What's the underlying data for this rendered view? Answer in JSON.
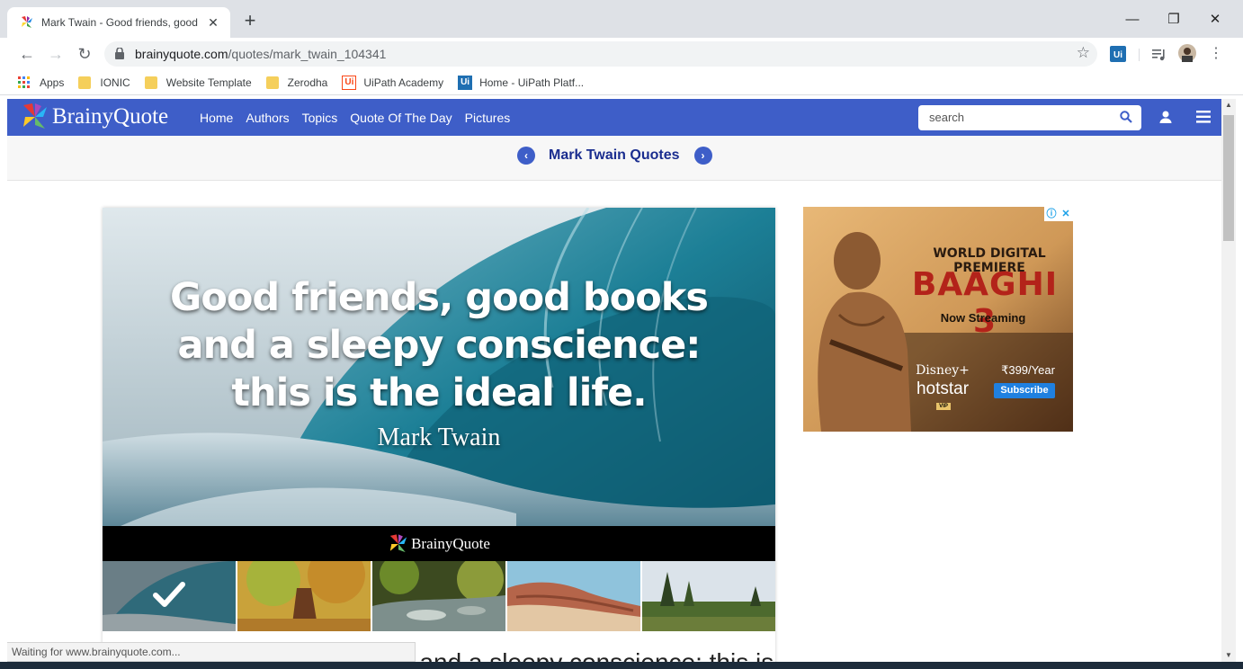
{
  "browser": {
    "tab_title": "Mark Twain - Good friends, good",
    "url_domain": "brainyquote.com",
    "url_path": "/quotes/mark_twain_104341",
    "status_text": "Waiting for www.brainyquote.com..."
  },
  "bookmarks": [
    {
      "label": "Apps",
      "icon": "apps-grid-icon"
    },
    {
      "label": "IONIC",
      "icon": "folder-icon"
    },
    {
      "label": "Website Template",
      "icon": "folder-icon"
    },
    {
      "label": "Zerodha",
      "icon": "folder-icon"
    },
    {
      "label": "UiPath Academy",
      "icon": "uipath-icon"
    },
    {
      "label": "Home - UiPath Platf...",
      "icon": "uipath-icon"
    }
  ],
  "site": {
    "brand": "BrainyQuote",
    "nav": [
      "Home",
      "Authors",
      "Topics",
      "Quote Of The Day",
      "Pictures"
    ],
    "search_placeholder": "search",
    "section_title": "Mark Twain Quotes",
    "accent_color": "#3e5ec8"
  },
  "quote": {
    "text": "Good friends, good books and a sleepy conscience: this is the ideal life.",
    "author": "Mark Twain",
    "strip_brand": "BrainyQuote",
    "body_preview": "Good friends, good books and a sleepy conscience: this is"
  },
  "ad": {
    "premiere": "WORLD DIGITAL PREMIERE",
    "title": "BAAGHI 3",
    "subtitle": "Now Streaming",
    "brand_top": "Disney+",
    "brand_bottom": "hotstar",
    "vip": "VIP",
    "price": "₹399/Year",
    "cta": "Subscribe"
  }
}
